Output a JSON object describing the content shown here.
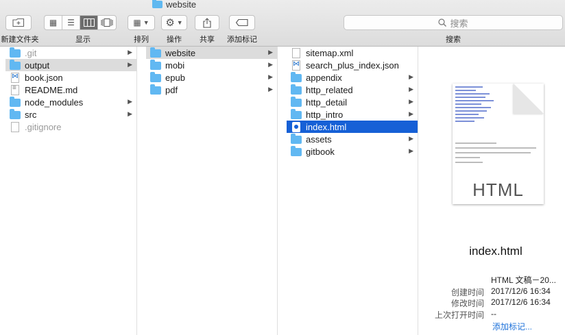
{
  "window": {
    "title": "website"
  },
  "toolbar": {
    "new_folder": "新建文件夹",
    "view": "显示",
    "arrange": "排列",
    "action": "操作",
    "share": "共享",
    "add_tags": "添加标记",
    "search_placeholder": "搜索",
    "search_label": "搜索"
  },
  "column1": [
    {
      "name": ".git",
      "type": "folder",
      "dim": true,
      "arrow": true
    },
    {
      "name": "output",
      "type": "folder",
      "selected": true,
      "arrow": true
    },
    {
      "name": "book.json",
      "type": "file-vs"
    },
    {
      "name": "README.md",
      "type": "file-txt"
    },
    {
      "name": "node_modules",
      "type": "folder",
      "arrow": true
    },
    {
      "name": "src",
      "type": "folder",
      "arrow": true
    },
    {
      "name": ".gitignore",
      "type": "file",
      "dim": true
    }
  ],
  "column2": [
    {
      "name": "website",
      "type": "folder",
      "selected": true,
      "arrow": true
    },
    {
      "name": "mobi",
      "type": "folder",
      "arrow": true
    },
    {
      "name": "epub",
      "type": "folder",
      "arrow": true
    },
    {
      "name": "pdf",
      "type": "folder",
      "arrow": true
    }
  ],
  "column3": [
    {
      "name": "sitemap.xml",
      "type": "file"
    },
    {
      "name": "search_plus_index.json",
      "type": "file-vs"
    },
    {
      "name": "appendix",
      "type": "folder",
      "arrow": true
    },
    {
      "name": "http_related",
      "type": "folder",
      "arrow": true
    },
    {
      "name": "http_detail",
      "type": "folder",
      "arrow": true
    },
    {
      "name": "http_intro",
      "type": "folder",
      "arrow": true
    },
    {
      "name": "index.html",
      "type": "html",
      "active": true
    },
    {
      "name": "assets",
      "type": "folder",
      "arrow": true
    },
    {
      "name": "gitbook",
      "type": "folder",
      "arrow": true
    }
  ],
  "preview": {
    "thumb_label": "HTML",
    "file_name": "index.html",
    "kind": "HTML 文稿－20...",
    "created_label": "创建时间",
    "created": "2017/12/6 16:34",
    "modified_label": "修改时间",
    "modified": "2017/12/6 16:34",
    "last_opened_label": "上次打开时间",
    "last_opened": "--",
    "add_tags": "添加标记..."
  },
  "icons": [
    "new-folder-icon",
    "icon-view-icon",
    "list-view-icon",
    "column-view-icon",
    "cover-flow-icon",
    "arrange-icon",
    "gear-icon",
    "share-icon",
    "tag-icon",
    "search-icon",
    "folder-icon",
    "file-icon"
  ]
}
